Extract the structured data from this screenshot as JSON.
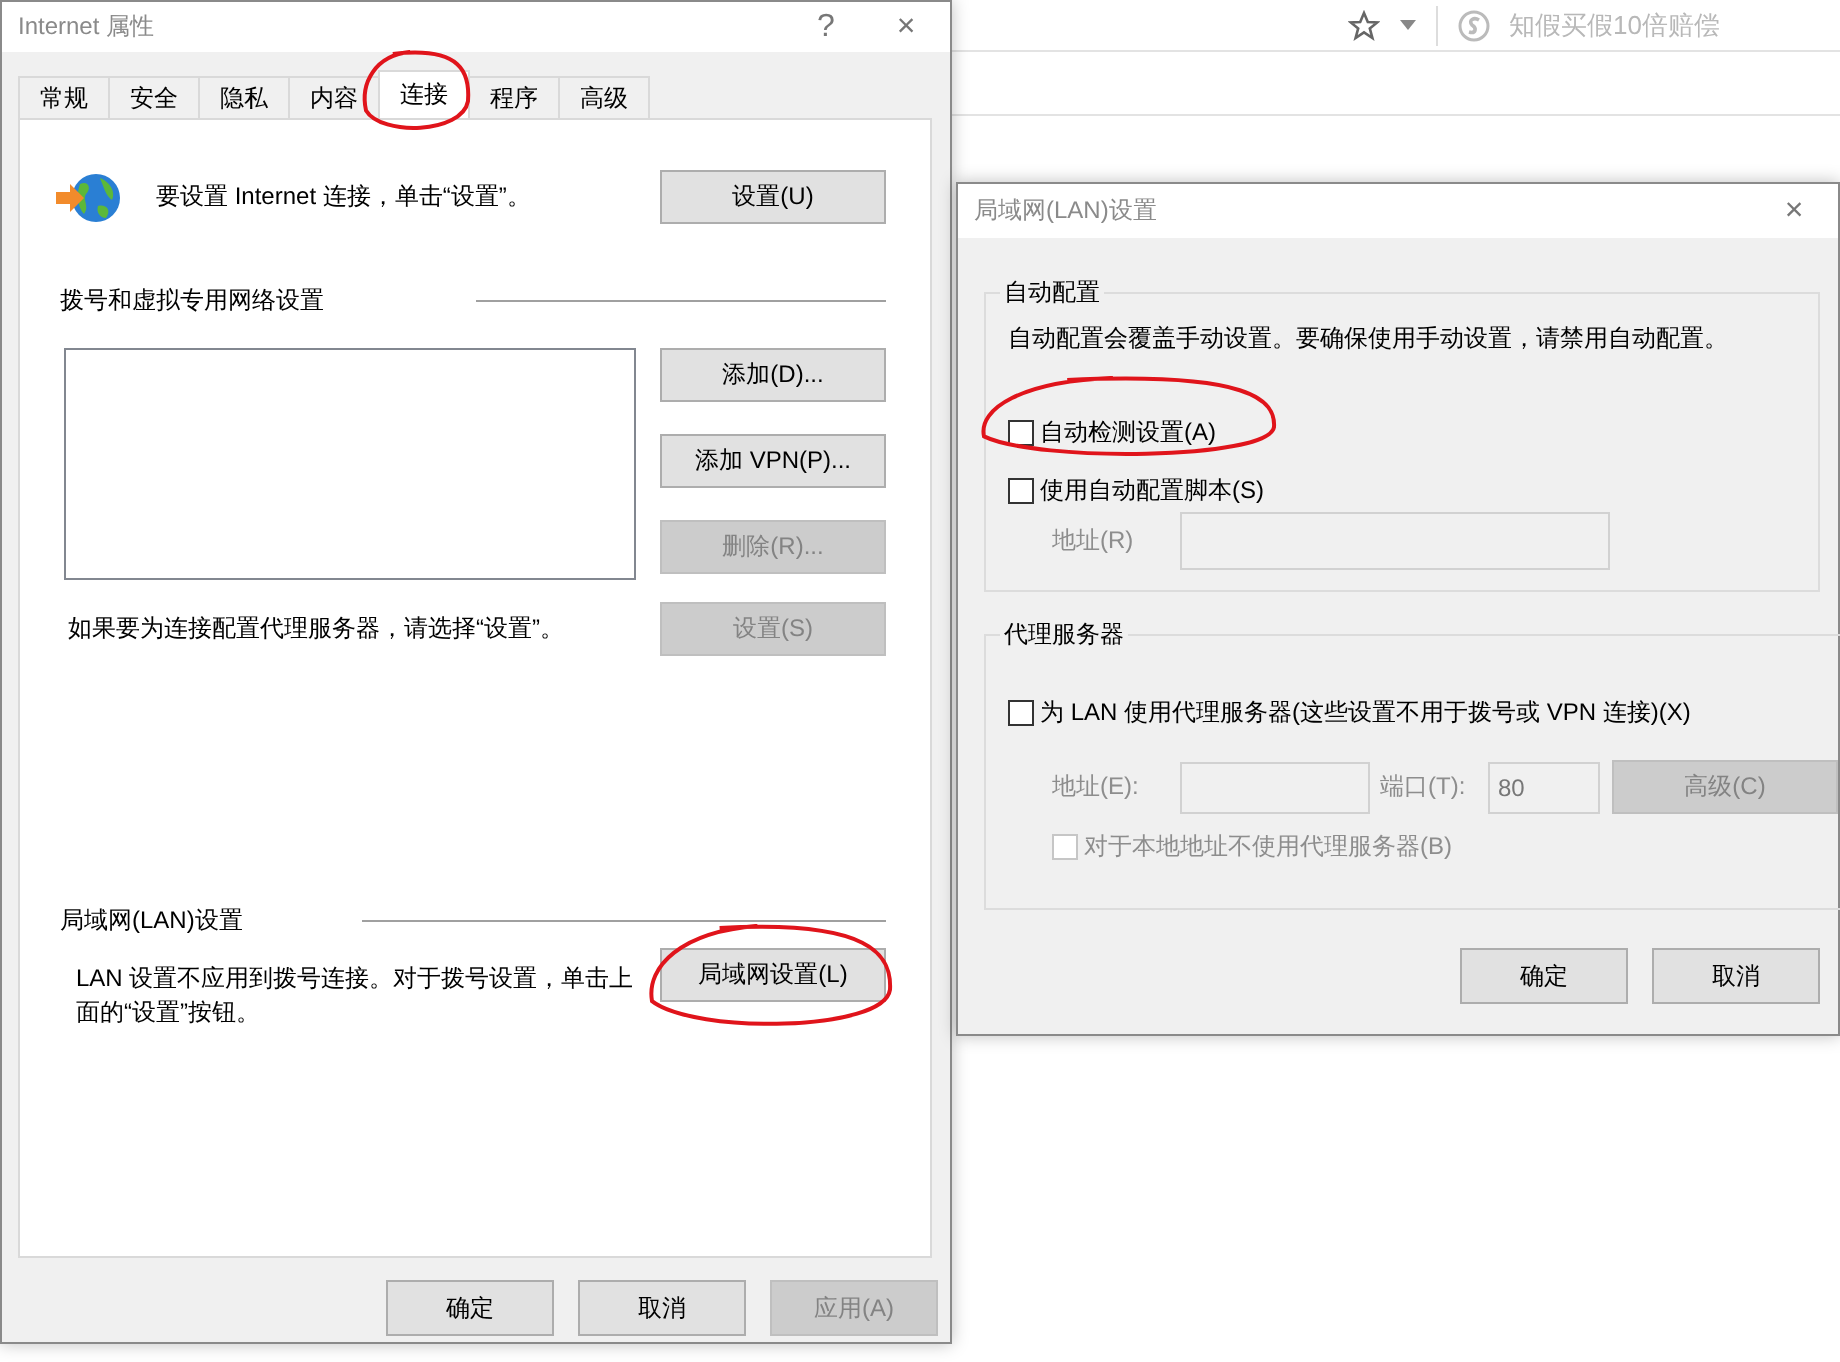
{
  "browser": {
    "search_hint": "知假买假10倍赔偿"
  },
  "internet_options": {
    "title": "Internet 属性",
    "help": "?",
    "close": "×",
    "tabs": [
      {
        "label": "常规",
        "selected": false,
        "circled": false
      },
      {
        "label": "安全",
        "selected": false,
        "circled": false
      },
      {
        "label": "隐私",
        "selected": false,
        "circled": false
      },
      {
        "label": "内容",
        "selected": false,
        "circled": false
      },
      {
        "label": "连接",
        "selected": true,
        "circled": true
      },
      {
        "label": "程序",
        "selected": false,
        "circled": false
      },
      {
        "label": "高级",
        "selected": false,
        "circled": false
      }
    ],
    "setup_prompt": "要设置 Internet 连接，单击“设置”。",
    "setup_button": "设置(U)",
    "dialup_section": {
      "title": "拨号和虚拟专用网络设置",
      "buttons": [
        {
          "label": "添加(D)...",
          "disabled": false
        },
        {
          "label": "添加 VPN(P)...",
          "disabled": false
        },
        {
          "label": "删除(R)...",
          "disabled": true
        }
      ]
    },
    "proxy_hint": "如果要为连接配置代理服务器，请选择“设置”。",
    "proxy_button": {
      "label": "设置(S)",
      "disabled": true
    },
    "lan_section": {
      "title": "局域网(LAN)设置",
      "description": "LAN 设置不应用到拨号连接。对于拨号设置，单击上面的“设置”按钮。",
      "button": {
        "label": "局域网设置(L)",
        "circled": true
      }
    },
    "footer_buttons": [
      {
        "label": "确定",
        "disabled": false
      },
      {
        "label": "取消",
        "disabled": false
      },
      {
        "label": "应用(A)",
        "disabled": true
      }
    ]
  },
  "lan_dialog": {
    "title": "局域网(LAN)设置",
    "close": "×",
    "auto_config": {
      "title": "自动配置",
      "description": "自动配置会覆盖手动设置。要确保使用手动设置，请禁用自动配置。",
      "options": [
        {
          "label": "自动检测设置(A)",
          "checked": false,
          "circled": true
        },
        {
          "label": "使用自动配置脚本(S)",
          "checked": false,
          "circled": false
        }
      ],
      "script_address": {
        "label": "地址(R)",
        "disabled": true
      }
    },
    "proxy": {
      "title": "代理服务器",
      "use_proxy": {
        "label": "为 LAN 使用代理服务器(这些设置不用于拨号或 VPN 连接)(X)",
        "checked": false
      },
      "address": {
        "label": "地址(E):",
        "disabled": true
      },
      "port": {
        "label": "端口(T):",
        "value": "80",
        "disabled": true
      },
      "advanced_button": {
        "label": "高级(C)",
        "disabled": true
      },
      "bypass_local": {
        "label": "对于本地地址不使用代理服务器(B)",
        "checked": false,
        "disabled": true
      }
    },
    "buttons": [
      {
        "label": "确定",
        "disabled": false
      },
      {
        "label": "取消",
        "disabled": false
      }
    ]
  }
}
